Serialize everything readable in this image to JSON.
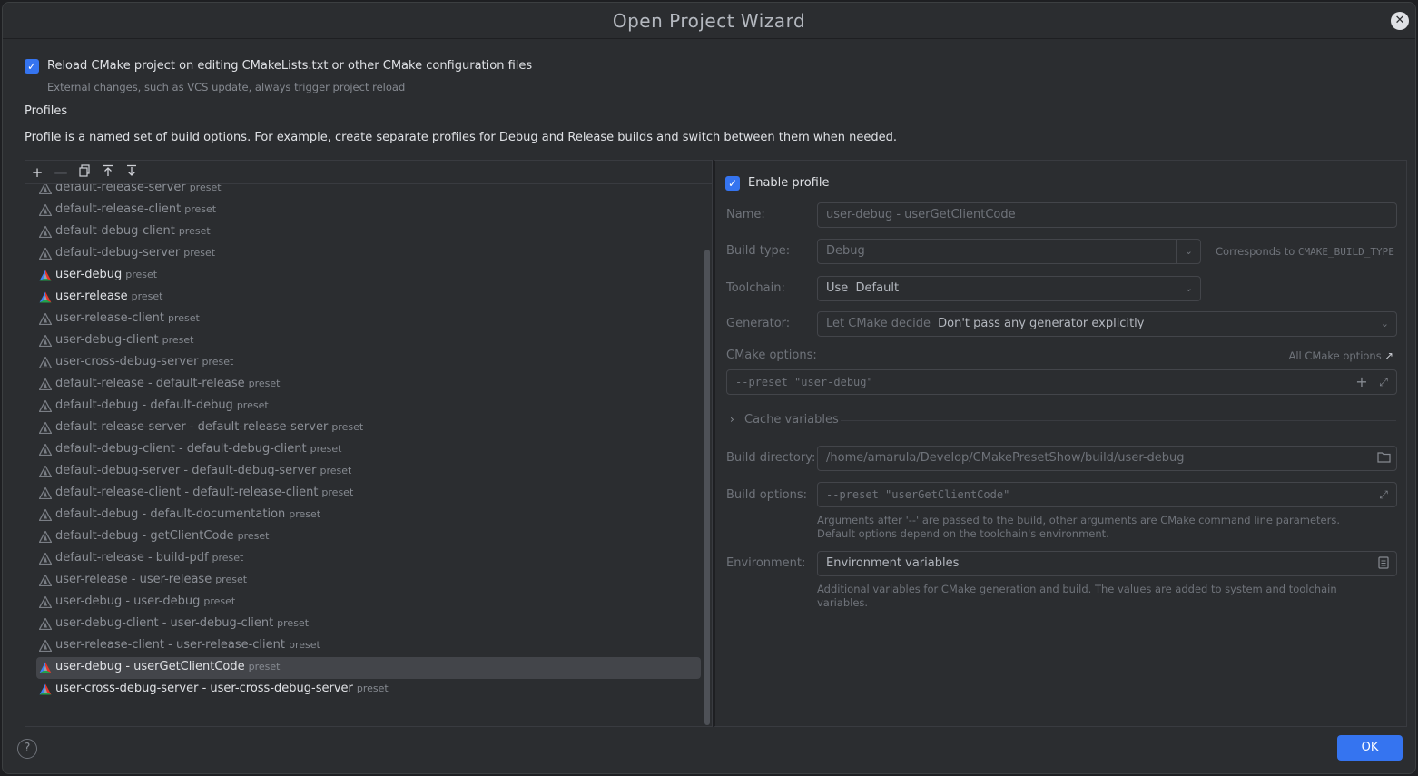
{
  "window": {
    "title": "Open Project Wizard"
  },
  "reload": {
    "checked": true,
    "label": "Reload CMake project on editing CMakeLists.txt or other CMake configuration files",
    "hint": "External changes, such as VCS update, always trigger project reload"
  },
  "profiles": {
    "section_title": "Profiles",
    "description": "Profile is a named set of build options. For example, create separate profiles for Debug and Release builds and switch between them when needed.",
    "toolbar": [
      "add-icon",
      "remove-icon",
      "copy-icon",
      "move-up-icon",
      "move-down-icon"
    ],
    "items": [
      {
        "name": "default-release-server",
        "tag": "preset",
        "active": false
      },
      {
        "name": "default-release-client",
        "tag": "preset",
        "active": false
      },
      {
        "name": "default-debug-client",
        "tag": "preset",
        "active": false
      },
      {
        "name": "default-debug-server",
        "tag": "preset",
        "active": false
      },
      {
        "name": "user-debug",
        "tag": "preset",
        "active": true
      },
      {
        "name": "user-release",
        "tag": "preset",
        "active": true
      },
      {
        "name": "user-release-client",
        "tag": "preset",
        "active": false
      },
      {
        "name": "user-debug-client",
        "tag": "preset",
        "active": false
      },
      {
        "name": "user-cross-debug-server",
        "tag": "preset",
        "active": false
      },
      {
        "name": "default-release - default-release",
        "tag": "preset",
        "active": false
      },
      {
        "name": "default-debug - default-debug",
        "tag": "preset",
        "active": false
      },
      {
        "name": "default-release-server - default-release-server",
        "tag": "preset",
        "active": false
      },
      {
        "name": "default-debug-client - default-debug-client",
        "tag": "preset",
        "active": false
      },
      {
        "name": "default-debug-server - default-debug-server",
        "tag": "preset",
        "active": false
      },
      {
        "name": "default-release-client - default-release-client",
        "tag": "preset",
        "active": false
      },
      {
        "name": "default-debug - default-documentation",
        "tag": "preset",
        "active": false
      },
      {
        "name": "default-debug - getClientCode",
        "tag": "preset",
        "active": false
      },
      {
        "name": "default-release - build-pdf",
        "tag": "preset",
        "active": false
      },
      {
        "name": "user-release - user-release",
        "tag": "preset",
        "active": false
      },
      {
        "name": "user-debug - user-debug",
        "tag": "preset",
        "active": false
      },
      {
        "name": "user-debug-client - user-debug-client",
        "tag": "preset",
        "active": false
      },
      {
        "name": "user-release-client - user-release-client",
        "tag": "preset",
        "active": false
      },
      {
        "name": "user-debug - userGetClientCode",
        "tag": "preset",
        "active": true,
        "selected": true
      },
      {
        "name": "user-cross-debug-server - user-cross-debug-server",
        "tag": "preset",
        "active": true
      }
    ]
  },
  "details": {
    "enable_profile": {
      "checked": true,
      "label": "Enable profile"
    },
    "name": {
      "label": "Name:",
      "value": "user-debug - userGetClientCode"
    },
    "build_type": {
      "label": "Build type:",
      "value": "Debug",
      "hint_prefix": "Corresponds to",
      "hint_code": "CMAKE_BUILD_TYPE"
    },
    "toolchain": {
      "label": "Toolchain:",
      "value": "Use  Default"
    },
    "generator": {
      "label": "Generator:",
      "value_prefix": "Let CMake decide",
      "value": "Don't pass any generator explicitly"
    },
    "cmake_options": {
      "label": "CMake options:",
      "link": "All CMake options",
      "value": "--preset \"user-debug\""
    },
    "cache_variables": {
      "label": "Cache variables"
    },
    "build_directory": {
      "label": "Build directory:",
      "value": "/home/amarula/Develop/CMakePresetShow/build/user-debug"
    },
    "build_options": {
      "label": "Build options:",
      "value": "--preset \"userGetClientCode\"",
      "hint_line1": "Arguments after '--' are passed to the build, other arguments are CMake command line parameters.",
      "hint_line2": "Default options depend on the toolchain's environment."
    },
    "environment": {
      "label": "Environment:",
      "value": "Environment variables",
      "hint_line1": "Additional variables for CMake generation and build. The values are added to system and toolchain",
      "hint_line2": "variables."
    }
  },
  "footer": {
    "help": "?",
    "ok": "OK"
  }
}
